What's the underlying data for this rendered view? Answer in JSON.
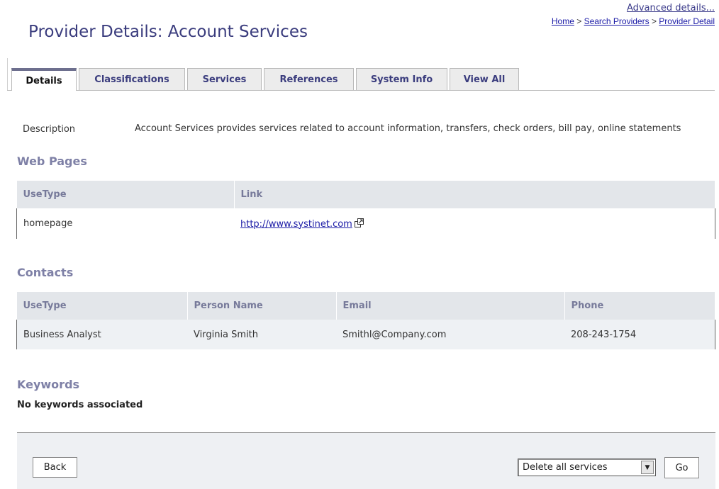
{
  "header": {
    "advanced_label": "Advanced details...",
    "breadcrumb": {
      "home": "Home",
      "sep1": " > ",
      "search": "Search Providers",
      "sep2": " > ",
      "current": "Provider Detail"
    },
    "title": "Provider Details: Account Services"
  },
  "tabs": [
    {
      "label": "Details",
      "active": true
    },
    {
      "label": "Classifications",
      "active": false
    },
    {
      "label": "Services",
      "active": false
    },
    {
      "label": "References",
      "active": false
    },
    {
      "label": "System Info",
      "active": false
    },
    {
      "label": "View All",
      "active": false
    }
  ],
  "description": {
    "label": "Description",
    "value": "Account Services provides services related to account information, transfers, check orders, bill pay, online statements"
  },
  "web_pages": {
    "heading": "Web Pages",
    "columns": [
      "UseType",
      "Link"
    ],
    "rows": [
      {
        "use_type": "homepage",
        "link": "http://www.systinet.com",
        "icon": "external-link-icon"
      }
    ]
  },
  "contacts": {
    "heading": "Contacts",
    "columns": [
      "UseType",
      "Person Name",
      "Email",
      "Phone"
    ],
    "rows": [
      {
        "use_type": "Business Analyst",
        "person": "Virginia Smith",
        "email": "Smithl@Company.com",
        "phone": "208-243-1754"
      }
    ]
  },
  "keywords": {
    "heading": "Keywords",
    "empty_text": "No keywords associated"
  },
  "footer": {
    "back_label": "Back",
    "select_value": "Delete all services",
    "go_label": "Go"
  },
  "colors": {
    "title": "#3b3d7e",
    "section_heading": "#7e80a6",
    "header_bg": "#e3e6ea",
    "footer_bg": "#eef0f3"
  }
}
